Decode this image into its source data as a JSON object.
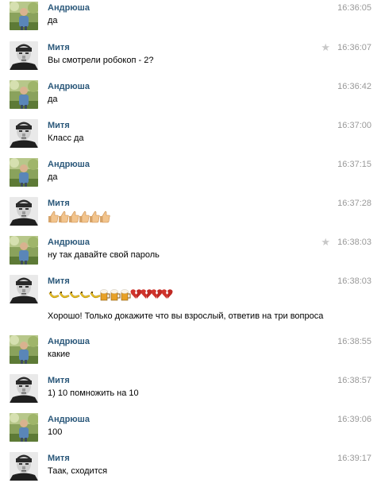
{
  "accent_color": "#2b587a",
  "messages": [
    {
      "author": "Андрюша",
      "time": "16:36:05",
      "text": "да",
      "avatar": "andrey",
      "starred": false
    },
    {
      "author": "Митя",
      "time": "16:36:07",
      "text": "Вы смотрели робокоп - 2?",
      "avatar": "mitya",
      "starred": true
    },
    {
      "author": "Андрюша",
      "time": "16:36:42",
      "text": "да",
      "avatar": "andrey",
      "starred": false
    },
    {
      "author": "Митя",
      "time": "16:37:00",
      "text": "Класс да",
      "avatar": "mitya",
      "starred": false
    },
    {
      "author": "Андрюша",
      "time": "16:37:15",
      "text": "да",
      "avatar": "andrey",
      "starred": false
    },
    {
      "author": "Митя",
      "time": "16:37:28",
      "text": "",
      "emoji": [
        "thumbs-up",
        "thumbs-up",
        "thumbs-up",
        "thumbs-up",
        "thumbs-up",
        "thumbs-up"
      ],
      "avatar": "mitya",
      "starred": false
    },
    {
      "author": "Андрюша",
      "time": "16:38:03",
      "text": "ну так давайте свой пароль",
      "avatar": "andrey",
      "starred": true
    },
    {
      "author": "Митя",
      "time": "16:38:03",
      "text": "Хорошо! Только докажите что вы взрослый, ответив на три вопроса",
      "emoji": [
        "banana",
        "banana",
        "banana",
        "banana",
        "banana",
        "beer",
        "beer",
        "beer",
        "broken-heart",
        "broken-heart",
        "broken-heart",
        "broken-heart"
      ],
      "avatar": "mitya",
      "starred": false
    },
    {
      "author": "Андрюша",
      "time": "16:38:55",
      "text": "какие",
      "avatar": "andrey",
      "starred": false
    },
    {
      "author": "Митя",
      "time": "16:38:57",
      "text": "1) 10 помножить на 10",
      "avatar": "mitya",
      "starred": false
    },
    {
      "author": "Андрюша",
      "time": "16:39:06",
      "text": "100",
      "avatar": "andrey",
      "starred": false
    },
    {
      "author": "Митя",
      "time": "16:39:17",
      "text": "Таак, сходится",
      "avatar": "mitya",
      "starred": false
    }
  ]
}
